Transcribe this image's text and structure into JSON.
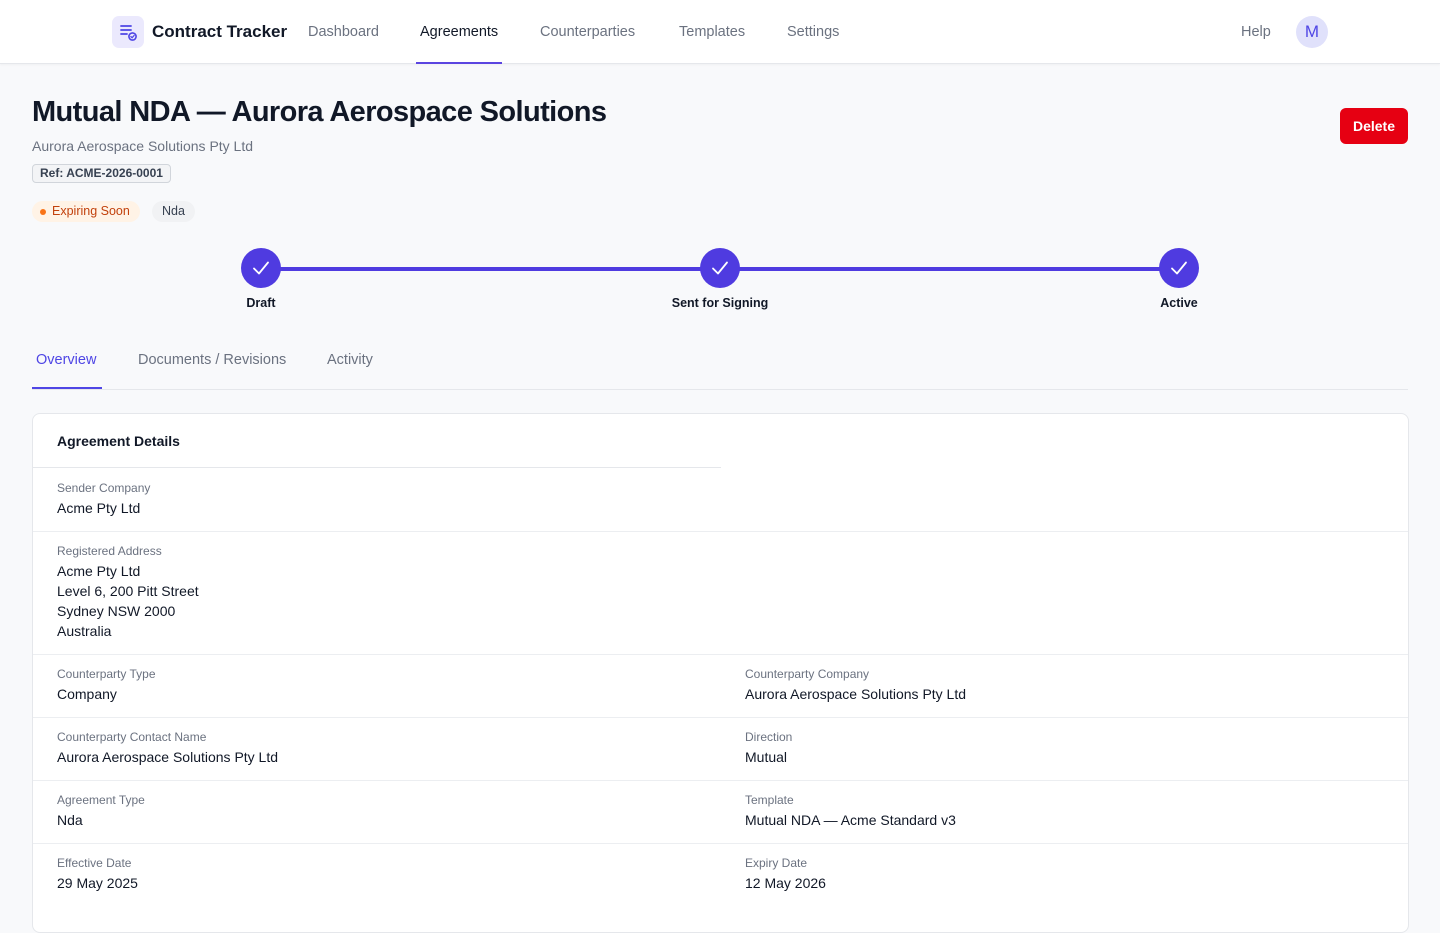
{
  "app": {
    "name": "Contract Tracker",
    "logo_icon": "document-list-icon",
    "accent_color": "#4f46e5"
  },
  "nav": {
    "items": [
      {
        "label": "Dashboard",
        "active": false
      },
      {
        "label": "Agreements",
        "active": true
      },
      {
        "label": "Counterparties",
        "active": false
      },
      {
        "label": "Templates",
        "active": false
      },
      {
        "label": "Settings",
        "active": false
      }
    ],
    "help_label": "Help",
    "avatar_initial": "M"
  },
  "header": {
    "title": "Mutual NDA — Aurora Aerospace Solutions",
    "subtitle": "Aurora Aerospace Solutions Pty Ltd",
    "reference": "Ref: ACME-2026-0001",
    "status_badge": "Expiring Soon",
    "status_color": "#c2410c",
    "type_badge": "Nda",
    "delete_label": "Delete",
    "delete_color": "#e60012"
  },
  "stepper": {
    "steps": [
      {
        "label": "Draft",
        "complete": true
      },
      {
        "label": "Sent for Signing",
        "complete": true
      },
      {
        "label": "Active",
        "complete": true
      }
    ],
    "step_icon": "checkmark-icon"
  },
  "tabs": [
    {
      "label": "Overview",
      "active": true
    },
    {
      "label": "Documents / Revisions",
      "active": false
    },
    {
      "label": "Activity",
      "active": false
    }
  ],
  "details": {
    "title": "Agreement Details",
    "sender_company": {
      "label": "Sender Company",
      "value": "Acme Pty Ltd"
    },
    "registered_address": {
      "label": "Registered Address",
      "lines": [
        "Acme Pty Ltd",
        "Level 6, 200 Pitt Street",
        "Sydney NSW 2000",
        "Australia"
      ]
    },
    "counterparty_type": {
      "label": "Counterparty Type",
      "value": "Company"
    },
    "counterparty_company": {
      "label": "Counterparty Company",
      "value": "Aurora Aerospace Solutions Pty Ltd"
    },
    "counterparty_contact": {
      "label": "Counterparty Contact Name",
      "value": "Aurora Aerospace Solutions Pty Ltd"
    },
    "direction": {
      "label": "Direction",
      "value": "Mutual"
    },
    "agreement_type": {
      "label": "Agreement Type",
      "value": "Nda"
    },
    "template": {
      "label": "Template",
      "value": "Mutual NDA — Acme Standard v3"
    },
    "effective_date": {
      "label": "Effective Date",
      "value": "29 May 2025"
    },
    "expiry_date": {
      "label": "Expiry Date",
      "value": "12 May 2026"
    }
  }
}
